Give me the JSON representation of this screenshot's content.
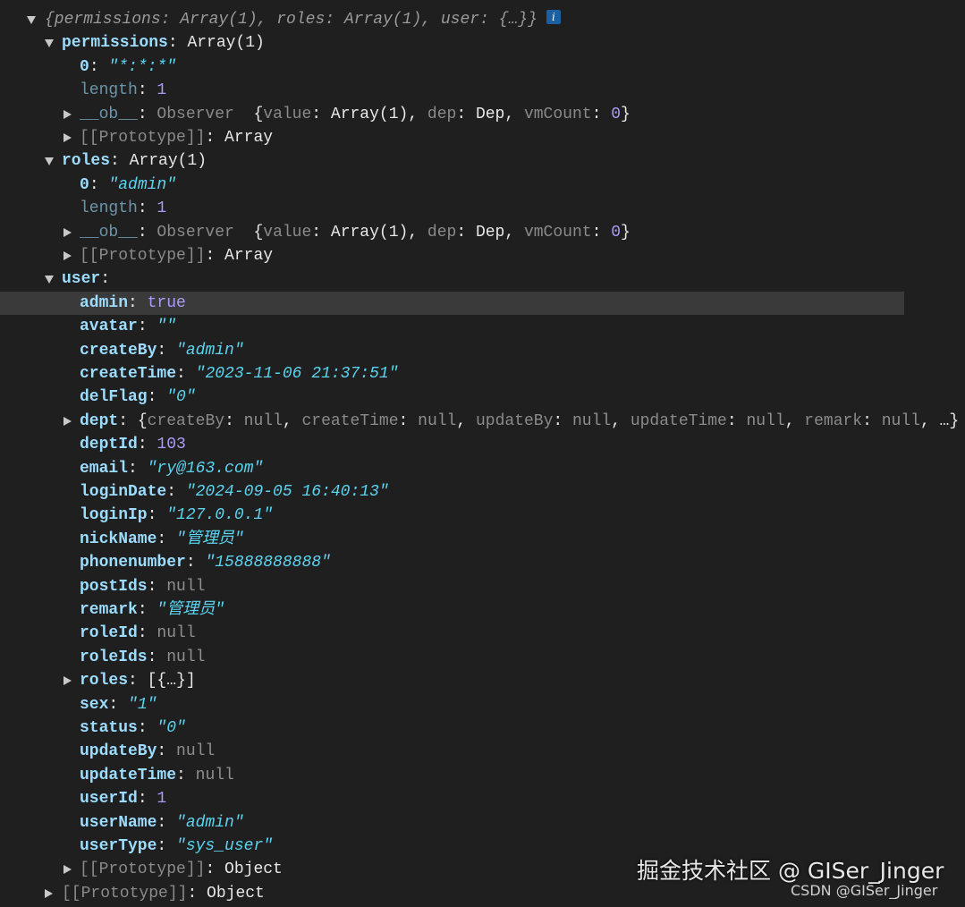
{
  "console": {
    "rows": [
      {
        "type": "summary",
        "expander": "down",
        "indent": 0,
        "text": "{permissions: Array(1), roles: Array(1), user: {…}}",
        "badge": "i"
      },
      {
        "type": "kv",
        "expander": "down",
        "indent": 1,
        "key": "permissions",
        "key_style": "key",
        "sep": ": ",
        "value": "Array(1)",
        "value_style": "obj"
      },
      {
        "type": "kv",
        "expander": "none",
        "indent": 2,
        "key": "0",
        "key_style": "key",
        "sep": ": ",
        "value": "\"*:*:*\"",
        "value_style": "str"
      },
      {
        "type": "kv",
        "expander": "none",
        "indent": 2,
        "key": "length",
        "key_style": "key-dim",
        "sep": ": ",
        "value": "1",
        "value_style": "num"
      },
      {
        "type": "ob",
        "expander": "right",
        "indent": 2,
        "key": "__ob__",
        "key_style": "key-dim",
        "sep": ": ",
        "value": "Observer",
        "value_style": "proto",
        "extra": [
          "{",
          "value",
          ": ",
          "Array(1)",
          ", ",
          "dep",
          ": ",
          "Dep",
          ", ",
          "vmCount",
          ": ",
          "0",
          "}"
        ]
      },
      {
        "type": "kv",
        "expander": "right",
        "indent": 2,
        "key": "[[Prototype]]",
        "key_style": "proto",
        "sep": ": ",
        "value": "Array",
        "value_style": "obj"
      },
      {
        "type": "kv",
        "expander": "down",
        "indent": 1,
        "key": "roles",
        "key_style": "key",
        "sep": ": ",
        "value": "Array(1)",
        "value_style": "obj"
      },
      {
        "type": "kv",
        "expander": "none",
        "indent": 2,
        "key": "0",
        "key_style": "key",
        "sep": ": ",
        "value": "\"admin\"",
        "value_style": "str"
      },
      {
        "type": "kv",
        "expander": "none",
        "indent": 2,
        "key": "length",
        "key_style": "key-dim",
        "sep": ": ",
        "value": "1",
        "value_style": "num"
      },
      {
        "type": "ob",
        "expander": "right",
        "indent": 2,
        "key": "__ob__",
        "key_style": "key-dim",
        "sep": ": ",
        "value": "Observer",
        "value_style": "proto",
        "extra": [
          "{",
          "value",
          ": ",
          "Array(1)",
          ", ",
          "dep",
          ": ",
          "Dep",
          ", ",
          "vmCount",
          ": ",
          "0",
          "}"
        ]
      },
      {
        "type": "kv",
        "expander": "right",
        "indent": 2,
        "key": "[[Prototype]]",
        "key_style": "proto",
        "sep": ": ",
        "value": "Array",
        "value_style": "obj"
      },
      {
        "type": "kv",
        "expander": "down",
        "indent": 1,
        "key": "user",
        "key_style": "key",
        "sep": ":",
        "value": "",
        "value_style": "obj"
      },
      {
        "type": "kv",
        "expander": "none",
        "indent": 2,
        "key": "admin",
        "key_style": "key",
        "sep": ": ",
        "value": "true",
        "value_style": "bool",
        "highlight": true
      },
      {
        "type": "kv",
        "expander": "none",
        "indent": 2,
        "key": "avatar",
        "key_style": "key",
        "sep": ": ",
        "value": "\"\"",
        "value_style": "str"
      },
      {
        "type": "kv",
        "expander": "none",
        "indent": 2,
        "key": "createBy",
        "key_style": "key",
        "sep": ": ",
        "value": "\"admin\"",
        "value_style": "str"
      },
      {
        "type": "kv",
        "expander": "none",
        "indent": 2,
        "key": "createTime",
        "key_style": "key",
        "sep": ": ",
        "value": "\"2023-11-06 21:37:51\"",
        "value_style": "str"
      },
      {
        "type": "kv",
        "expander": "none",
        "indent": 2,
        "key": "delFlag",
        "key_style": "key",
        "sep": ": ",
        "value": "\"0\"",
        "value_style": "str"
      },
      {
        "type": "dept",
        "expander": "right",
        "indent": 2,
        "key": "dept",
        "key_style": "key",
        "sep": ": ",
        "extra": [
          "{",
          "createBy",
          ": ",
          "null",
          ", ",
          "createTime",
          ": ",
          "null",
          ", ",
          "updateBy",
          ": ",
          "null",
          ", ",
          "updateTime",
          ": ",
          "null",
          ", ",
          "remark",
          ": ",
          "null",
          ",  …}"
        ]
      },
      {
        "type": "kv",
        "expander": "none",
        "indent": 2,
        "key": "deptId",
        "key_style": "key",
        "sep": ": ",
        "value": "103",
        "value_style": "num"
      },
      {
        "type": "kv",
        "expander": "none",
        "indent": 2,
        "key": "email",
        "key_style": "key",
        "sep": ": ",
        "value": "\"ry@163.com\"",
        "value_style": "str"
      },
      {
        "type": "kv",
        "expander": "none",
        "indent": 2,
        "key": "loginDate",
        "key_style": "key",
        "sep": ": ",
        "value": "\"2024-09-05 16:40:13\"",
        "value_style": "str"
      },
      {
        "type": "kv",
        "expander": "none",
        "indent": 2,
        "key": "loginIp",
        "key_style": "key",
        "sep": ": ",
        "value": "\"127.0.0.1\"",
        "value_style": "str"
      },
      {
        "type": "kv",
        "expander": "none",
        "indent": 2,
        "key": "nickName",
        "key_style": "key",
        "sep": ": ",
        "value": "\"管理员\"",
        "value_style": "str"
      },
      {
        "type": "kv",
        "expander": "none",
        "indent": 2,
        "key": "phonenumber",
        "key_style": "key",
        "sep": ": ",
        "value": "\"15888888888\"",
        "value_style": "str"
      },
      {
        "type": "kv",
        "expander": "none",
        "indent": 2,
        "key": "postIds",
        "key_style": "key",
        "sep": ": ",
        "value": "null",
        "value_style": "null"
      },
      {
        "type": "kv",
        "expander": "none",
        "indent": 2,
        "key": "remark",
        "key_style": "key",
        "sep": ": ",
        "value": "\"管理员\"",
        "value_style": "str"
      },
      {
        "type": "kv",
        "expander": "none",
        "indent": 2,
        "key": "roleId",
        "key_style": "key",
        "sep": ": ",
        "value": "null",
        "value_style": "null"
      },
      {
        "type": "kv",
        "expander": "none",
        "indent": 2,
        "key": "roleIds",
        "key_style": "key",
        "sep": ": ",
        "value": "null",
        "value_style": "null"
      },
      {
        "type": "kv",
        "expander": "right",
        "indent": 2,
        "key": "roles",
        "key_style": "key",
        "sep": ": ",
        "value": "[{…}]",
        "value_style": "obj"
      },
      {
        "type": "kv",
        "expander": "none",
        "indent": 2,
        "key": "sex",
        "key_style": "key",
        "sep": ": ",
        "value": "\"1\"",
        "value_style": "str"
      },
      {
        "type": "kv",
        "expander": "none",
        "indent": 2,
        "key": "status",
        "key_style": "key",
        "sep": ": ",
        "value": "\"0\"",
        "value_style": "str"
      },
      {
        "type": "kv",
        "expander": "none",
        "indent": 2,
        "key": "updateBy",
        "key_style": "key",
        "sep": ": ",
        "value": "null",
        "value_style": "null"
      },
      {
        "type": "kv",
        "expander": "none",
        "indent": 2,
        "key": "updateTime",
        "key_style": "key",
        "sep": ": ",
        "value": "null",
        "value_style": "null"
      },
      {
        "type": "kv",
        "expander": "none",
        "indent": 2,
        "key": "userId",
        "key_style": "key",
        "sep": ": ",
        "value": "1",
        "value_style": "num"
      },
      {
        "type": "kv",
        "expander": "none",
        "indent": 2,
        "key": "userName",
        "key_style": "key",
        "sep": ": ",
        "value": "\"admin\"",
        "value_style": "str"
      },
      {
        "type": "kv",
        "expander": "none",
        "indent": 2,
        "key": "userType",
        "key_style": "key",
        "sep": ": ",
        "value": "\"sys_user\"",
        "value_style": "str"
      },
      {
        "type": "kv",
        "expander": "right",
        "indent": 2,
        "key": "[[Prototype]]",
        "key_style": "proto",
        "sep": ": ",
        "value": "Object",
        "value_style": "obj"
      },
      {
        "type": "kv",
        "expander": "right",
        "indent": 1,
        "key": "[[Prototype]]",
        "key_style": "proto",
        "sep": ": ",
        "value": "Object",
        "value_style": "obj"
      }
    ]
  },
  "watermark": {
    "main": "掘金技术社区 @ GISer_Jinger",
    "sub": "CSDN @GISer_Jinger"
  },
  "colors": {
    "background": "#1f1f1f",
    "key": "#9cdcfe",
    "string": "#5cd4f0",
    "number": "#a99cf7",
    "null": "#8f8f8f",
    "highlight_row": "#3a3a3a"
  }
}
